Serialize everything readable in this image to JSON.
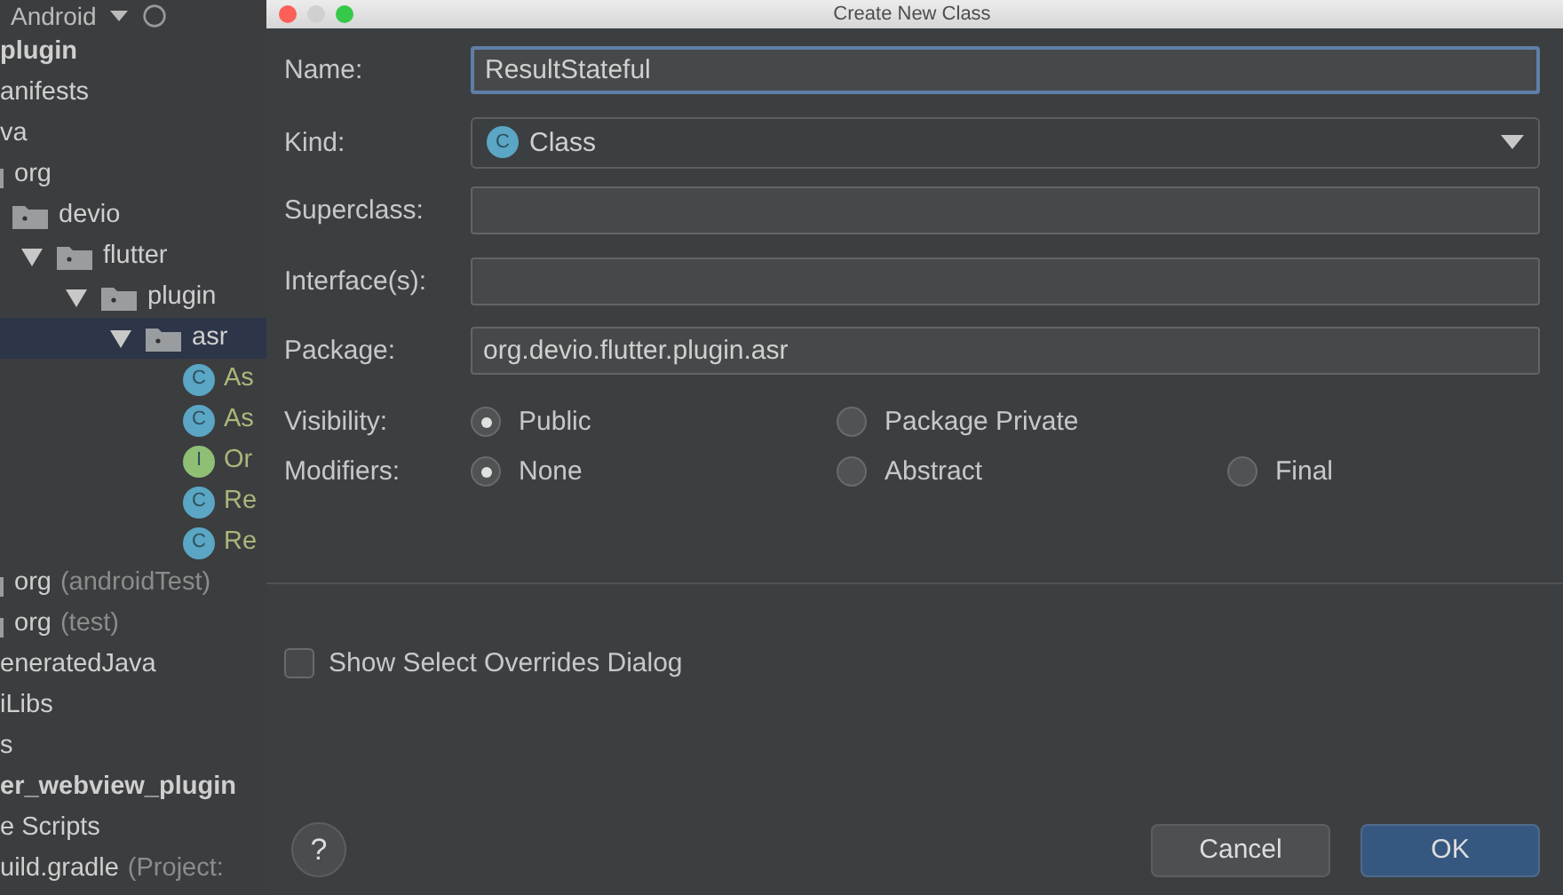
{
  "sidebar": {
    "header": {
      "label": "Android"
    },
    "items": [
      {
        "label": "plugin",
        "kind": "label",
        "bold": true,
        "selected": false
      },
      {
        "label": "anifests",
        "kind": "label",
        "bold": false,
        "selected": false
      },
      {
        "label": "va",
        "kind": "label",
        "bold": false,
        "selected": false
      },
      {
        "label": "org",
        "kind": "folder",
        "bold": false,
        "selected": false,
        "children": [
          {
            "label": "devio",
            "kind": "folder",
            "bold": false,
            "selected": false,
            "children": [
              {
                "label": "flutter",
                "kind": "folder",
                "bold": false,
                "selected": false,
                "expanded": true,
                "children": [
                  {
                    "label": "plugin",
                    "kind": "folder",
                    "bold": false,
                    "selected": false,
                    "expanded": true,
                    "children": [
                      {
                        "label": "asr",
                        "kind": "folder",
                        "bold": false,
                        "selected": true,
                        "expanded": true,
                        "children": [
                          {
                            "label": "As",
                            "kind": "class",
                            "badge": "C",
                            "bold": false,
                            "selected": false
                          },
                          {
                            "label": "As",
                            "kind": "class",
                            "badge": "C",
                            "bold": false,
                            "selected": false
                          },
                          {
                            "label": "Or",
                            "kind": "interface",
                            "badge": "I",
                            "bold": false,
                            "selected": false
                          },
                          {
                            "label": "Re",
                            "kind": "class",
                            "badge": "C",
                            "bold": false,
                            "selected": false
                          },
                          {
                            "label": "Re",
                            "kind": "class",
                            "badge": "C",
                            "bold": false,
                            "selected": false
                          }
                        ]
                      }
                    ]
                  }
                ]
              }
            ]
          }
        ]
      },
      {
        "label": "org",
        "suffix": "(androidTest)",
        "kind": "folder",
        "bold": false,
        "selected": false
      },
      {
        "label": "org",
        "suffix": "(test)",
        "kind": "folder",
        "bold": false,
        "selected": false
      },
      {
        "label": "eneratedJava",
        "kind": "label",
        "bold": false,
        "selected": false
      },
      {
        "label": "iLibs",
        "kind": "label",
        "bold": false,
        "selected": false
      },
      {
        "label": "s",
        "kind": "label",
        "bold": false,
        "selected": false
      },
      {
        "label": "er_webview_plugin",
        "kind": "label",
        "bold": true,
        "selected": false
      },
      {
        "label": "e Scripts",
        "kind": "label",
        "bold": false,
        "selected": false
      },
      {
        "label": "uild.gradle",
        "suffix": "(Project:",
        "kind": "label",
        "bold": false,
        "selected": false
      }
    ]
  },
  "dialog": {
    "title": "Create New Class",
    "fields": [
      {
        "label": "Name:",
        "kind": "text",
        "value": "ResultStateful",
        "focused": true
      },
      {
        "label": "Kind:",
        "kind": "select",
        "value": "Class",
        "badge": "C"
      },
      {
        "label": "Superclass:",
        "kind": "text",
        "focused": false
      },
      {
        "label": "Interface(s):",
        "kind": "text",
        "focused": false
      },
      {
        "label": "Package:",
        "kind": "text",
        "value": "org.devio.flutter.plugin.asr",
        "focused": false
      }
    ],
    "radio_groups": [
      {
        "label": "Visibility:",
        "options": [
          {
            "label": "Public",
            "selected": true
          },
          {
            "label": "Package Private",
            "selected": false
          }
        ]
      },
      {
        "label": "Modifiers:",
        "options": [
          {
            "label": "None",
            "selected": true
          },
          {
            "label": "Abstract",
            "selected": false
          },
          {
            "label": "Final",
            "selected": false
          }
        ]
      }
    ],
    "checkbox": {
      "label": "Show Select Overrides Dialog",
      "checked": false
    },
    "help": {
      "label": "?"
    },
    "buttons": [
      {
        "label": "Cancel",
        "kind": "secondary"
      },
      {
        "label": "OK",
        "kind": "primary"
      }
    ]
  }
}
